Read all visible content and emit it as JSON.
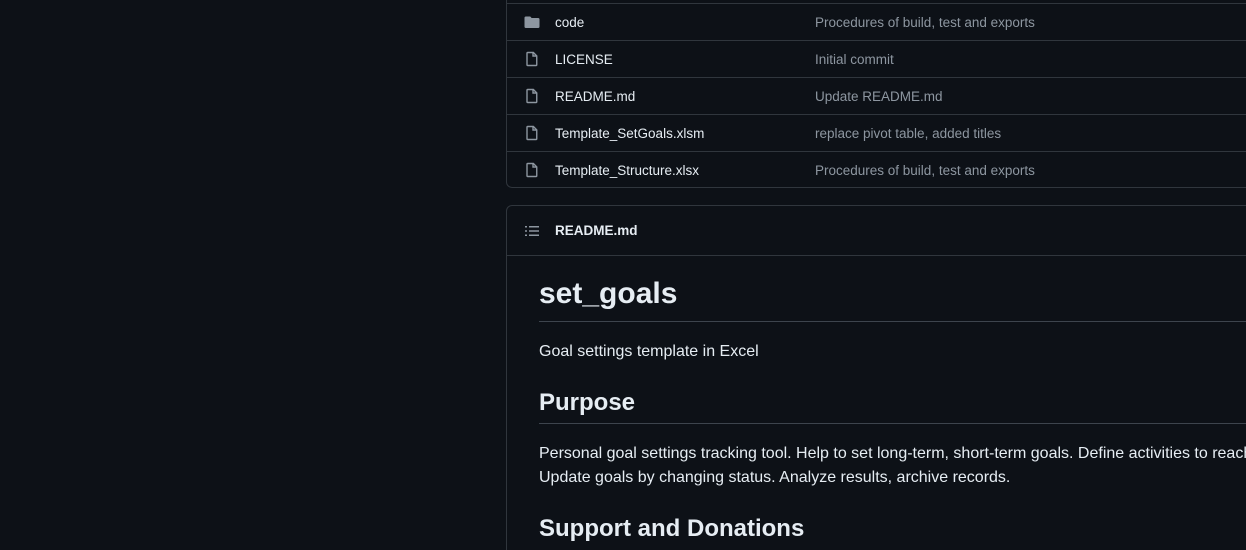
{
  "files": [
    {
      "name": "code",
      "icon": "folder-icon",
      "commit": "Procedures of build, test and exports"
    },
    {
      "name": "LICENSE",
      "icon": "file-icon",
      "commit": "Initial commit"
    },
    {
      "name": "README.md",
      "icon": "file-icon",
      "commit": "Update README.md"
    },
    {
      "name": "Template_SetGoals.xlsm",
      "icon": "file-icon",
      "commit": "replace pivot table, added titles"
    },
    {
      "name": "Template_Structure.xlsx",
      "icon": "file-icon",
      "commit": "Procedures of build, test and exports"
    }
  ],
  "readme": {
    "header_title": "README.md",
    "header_icon": "list-icon",
    "title": "set_goals",
    "subtitle": "Goal settings template in Excel",
    "purpose_heading": "Purpose",
    "purpose_line1": "Personal goal settings tracking tool. Help to set long-term, short-term goals. Define activities to reach",
    "purpose_line2": "Update goals by changing status. Analyze results, archive records.",
    "support_heading": "Support and Donations"
  },
  "colors": {
    "background": "#0d1117",
    "border": "#30363d",
    "text": "#e6edf3",
    "muted": "#8d96a0",
    "folder": "#8d96a0"
  }
}
